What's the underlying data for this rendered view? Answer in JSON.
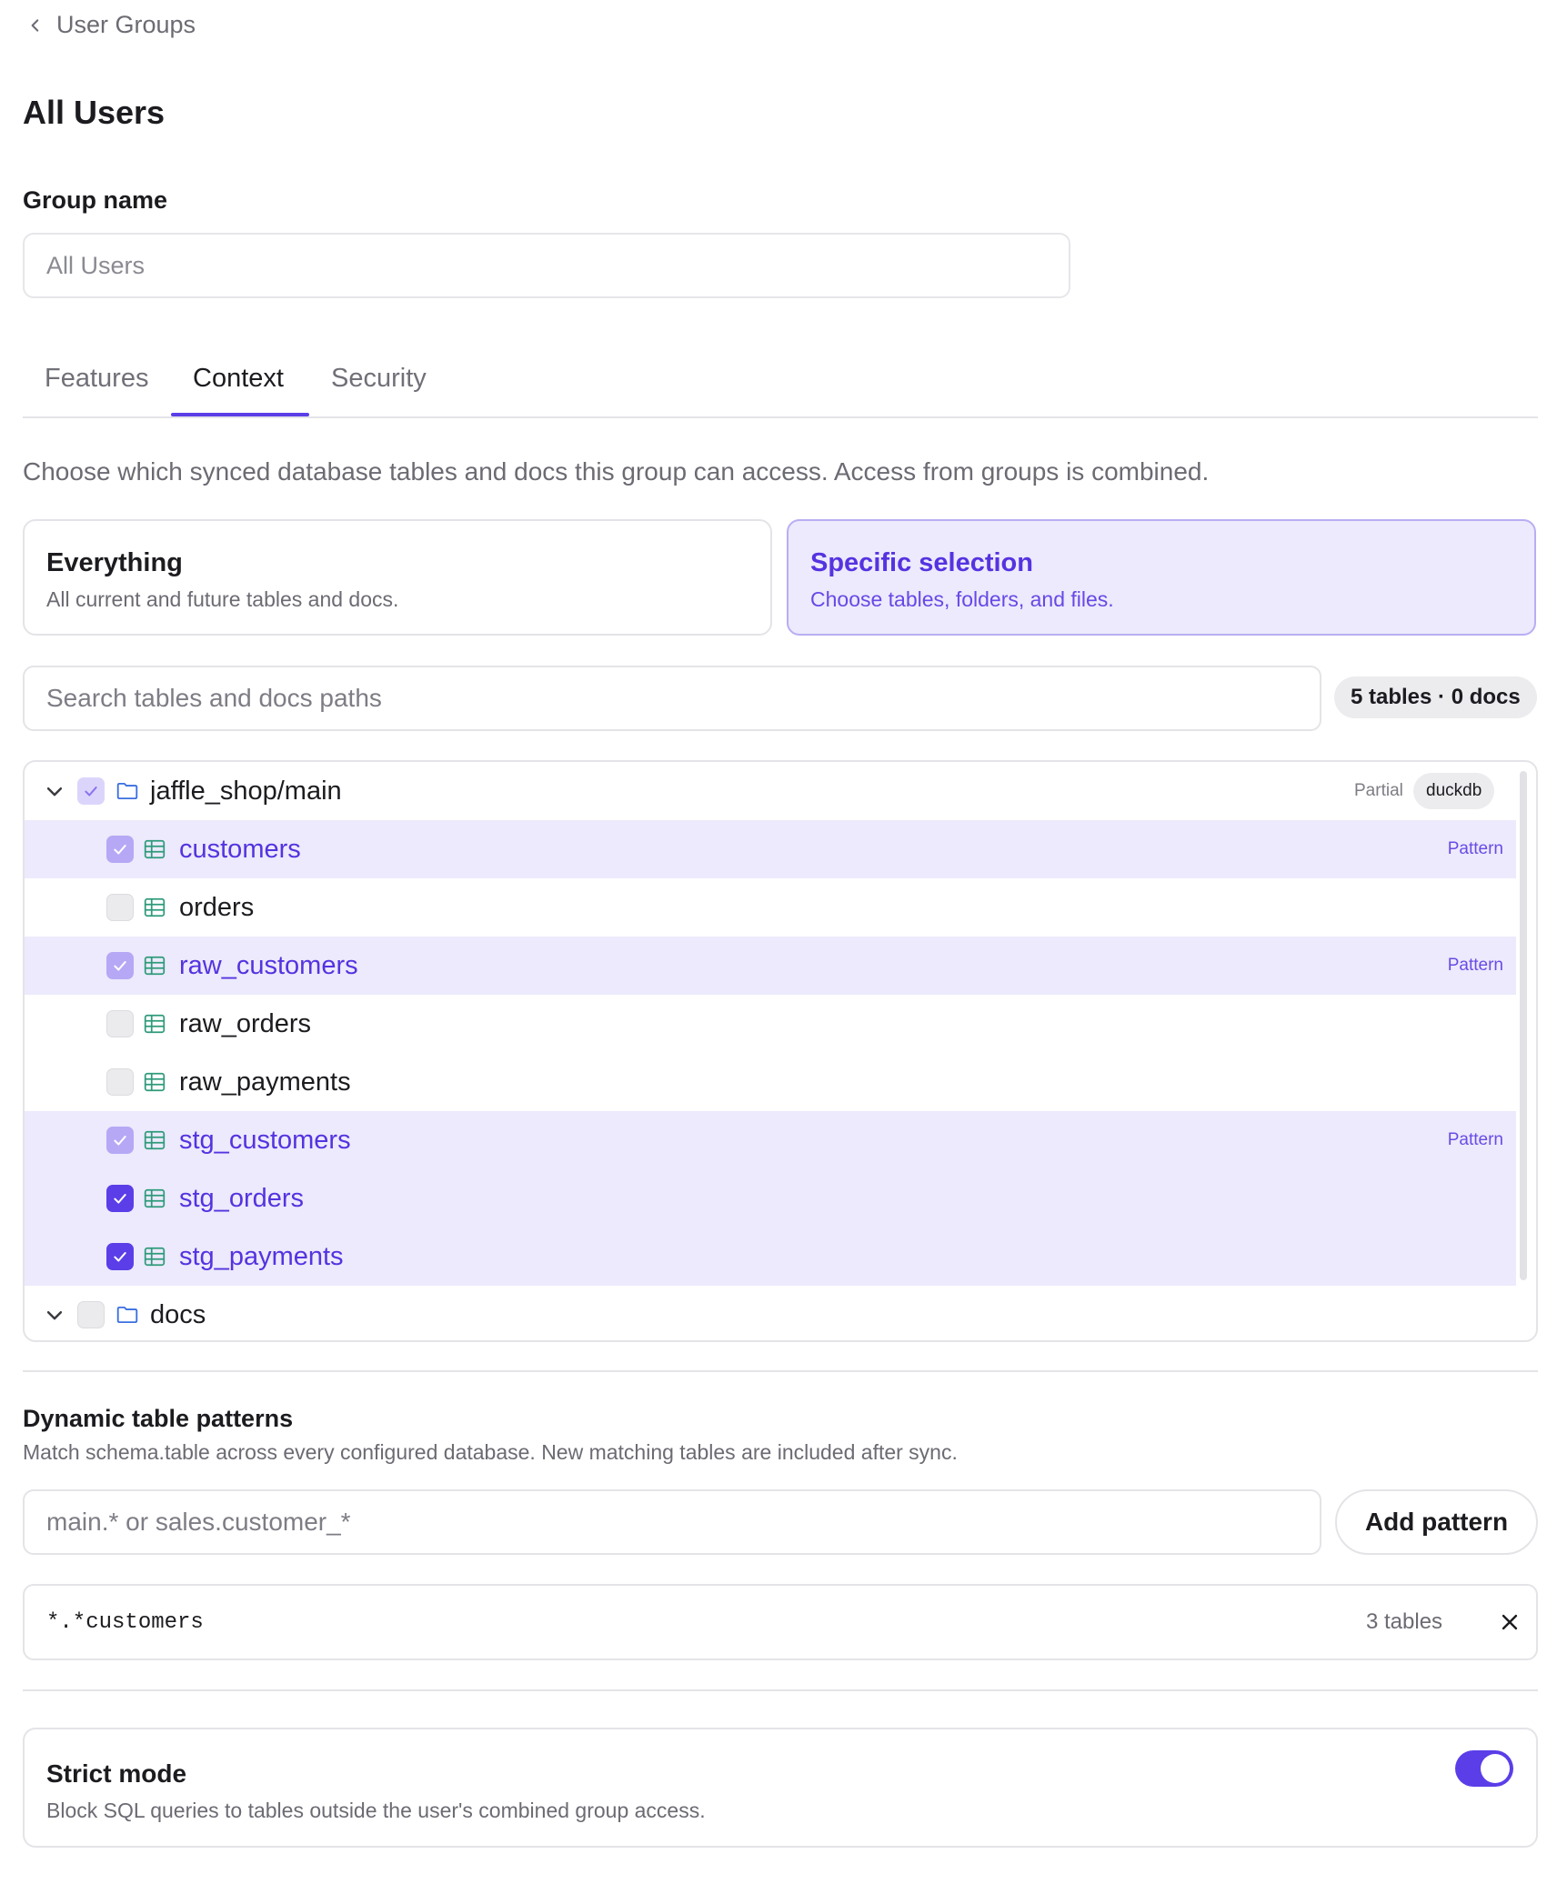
{
  "breadcrumb": {
    "back_label": "User Groups"
  },
  "page": {
    "title": "All Users"
  },
  "group_name": {
    "label": "Group name",
    "value": "All Users"
  },
  "tabs": [
    {
      "label": "Features",
      "active": false
    },
    {
      "label": "Context",
      "active": true
    },
    {
      "label": "Security",
      "active": false
    }
  ],
  "context": {
    "description": "Choose which synced database tables and docs this group can access. Access from groups is combined.",
    "options": [
      {
        "title": "Everything",
        "subtitle": "All current and future tables and docs.",
        "selected": false
      },
      {
        "title": "Specific selection",
        "subtitle": "Choose tables, folders, and files.",
        "selected": true
      }
    ],
    "search": {
      "placeholder": "Search tables and docs paths"
    },
    "count_badge": "5 tables · 0 docs",
    "tree": {
      "folder": {
        "name": "jaffle_shop/main",
        "status": "Partial",
        "source": "duckdb",
        "expanded": true,
        "check_state": "partial"
      },
      "tables": [
        {
          "name": "customers",
          "check_state": "pattern",
          "tag": "Pattern"
        },
        {
          "name": "orders",
          "check_state": "unchecked",
          "tag": ""
        },
        {
          "name": "raw_customers",
          "check_state": "pattern",
          "tag": "Pattern"
        },
        {
          "name": "raw_orders",
          "check_state": "unchecked",
          "tag": ""
        },
        {
          "name": "raw_payments",
          "check_state": "unchecked",
          "tag": ""
        },
        {
          "name": "stg_customers",
          "check_state": "pattern",
          "tag": "Pattern"
        },
        {
          "name": "stg_orders",
          "check_state": "checked",
          "tag": ""
        },
        {
          "name": "stg_payments",
          "check_state": "checked",
          "tag": ""
        }
      ],
      "docs_folder": {
        "name": "docs",
        "expanded": true,
        "check_state": "unchecked"
      }
    }
  },
  "dynamic_patterns": {
    "title": "Dynamic table patterns",
    "subtitle": "Match schema.table across every configured database. New matching tables are included after sync.",
    "input_placeholder": "main.* or sales.customer_*",
    "add_button": "Add pattern",
    "patterns": [
      {
        "pattern": "*.*customers",
        "match_count": "3 tables"
      }
    ]
  },
  "strict_mode": {
    "title": "Strict mode",
    "subtitle": "Block SQL queries to tables outside the user's combined group access.",
    "enabled": true
  },
  "colors": {
    "accent": "#5b3ee8",
    "selected_bg": "#eceafc",
    "table_icon": "#2e9a7a",
    "folder_icon": "#3b6fe0"
  }
}
